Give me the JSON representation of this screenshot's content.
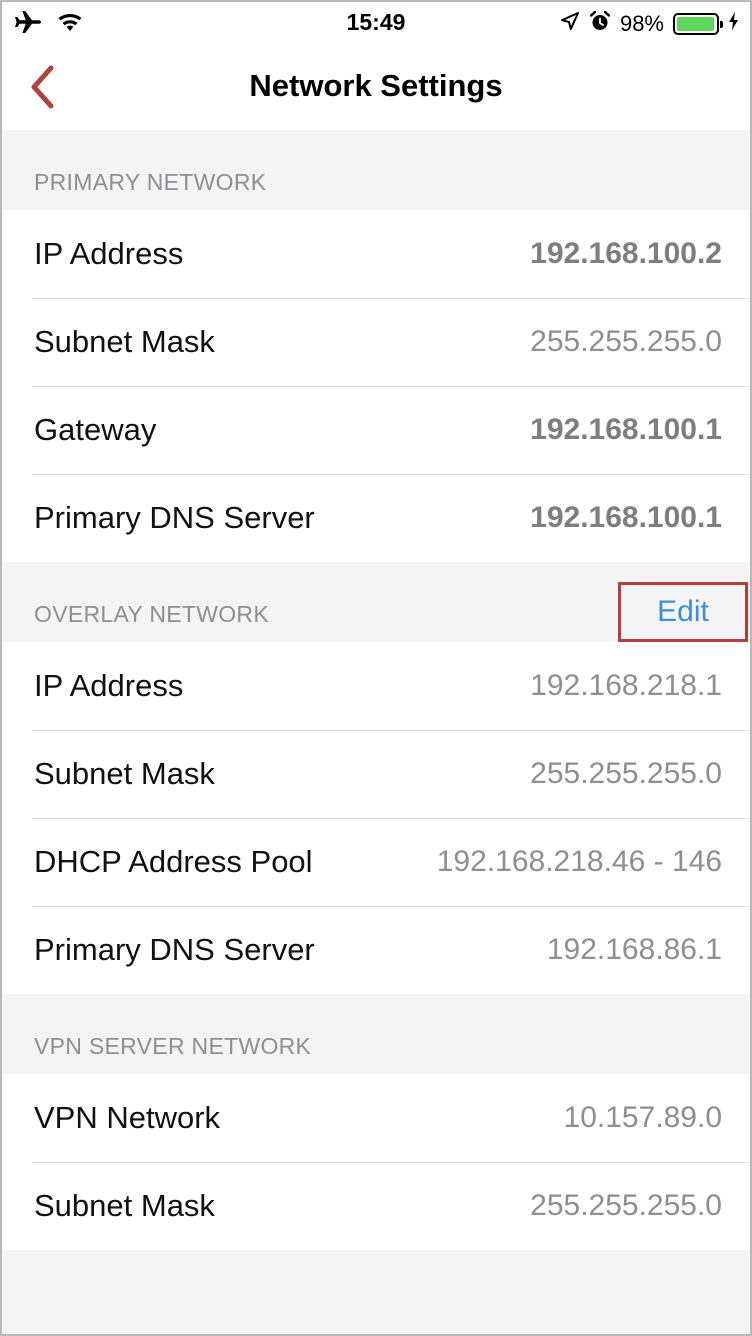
{
  "status_bar": {
    "time": "15:49",
    "battery_percent_text": "98%",
    "battery_level": 0.98,
    "icons": [
      "airplane-icon",
      "wifi-icon",
      "location-icon",
      "alarm-icon",
      "battery-icon",
      "charging-icon"
    ]
  },
  "nav": {
    "title": "Network Settings",
    "back_icon": "chevron-left-icon",
    "accent_color": "#b3403d"
  },
  "sections": {
    "primary": {
      "header": "PRIMARY NETWORK",
      "rows": [
        {
          "label": "IP Address",
          "value": "192.168.100.2"
        },
        {
          "label": "Subnet Mask",
          "value": "255.255.255.0"
        },
        {
          "label": "Gateway",
          "value": "192.168.100.1"
        },
        {
          "label": "Primary DNS Server",
          "value": "192.168.100.1"
        }
      ]
    },
    "overlay": {
      "header": "OVERLAY NETWORK",
      "edit_label": "Edit",
      "rows": [
        {
          "label": "IP Address",
          "value": "192.168.218.1"
        },
        {
          "label": "Subnet Mask",
          "value": "255.255.255.0"
        },
        {
          "label": "DHCP Address Pool",
          "value": "192.168.218.46 - 146"
        },
        {
          "label": "Primary DNS Server",
          "value": "192.168.86.1"
        }
      ]
    },
    "vpn": {
      "header": "VPN SERVER NETWORK",
      "rows": [
        {
          "label": "VPN Network",
          "value": "10.157.89.0"
        },
        {
          "label": "Subnet Mask",
          "value": "255.255.255.0"
        }
      ]
    }
  },
  "colors": {
    "link": "#3b8fd4",
    "highlight_border": "#b3403d",
    "battery_green": "#5fd35a"
  }
}
